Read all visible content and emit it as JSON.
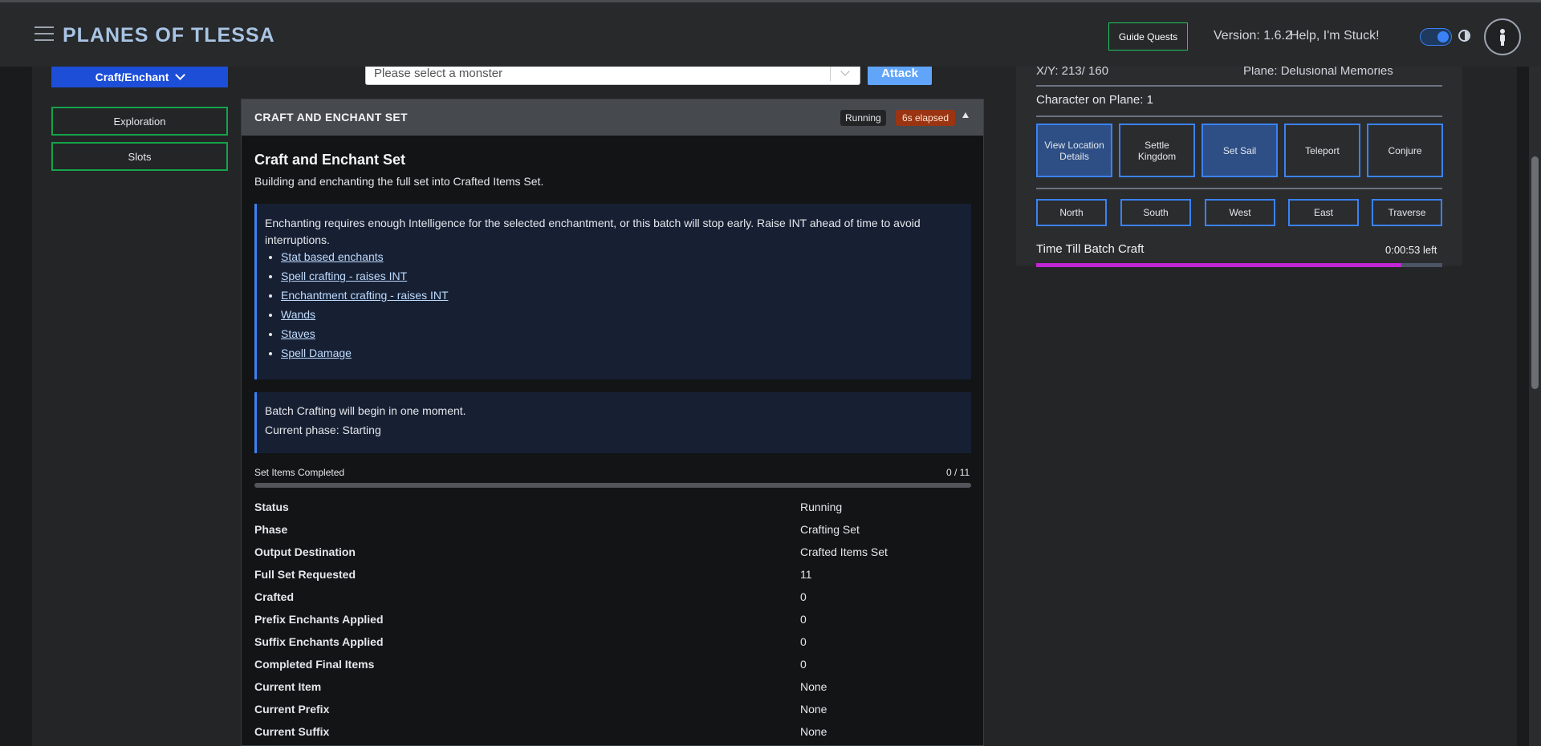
{
  "header": {
    "brand": "PLANES OF TLESSA",
    "guide_quests": "Guide Quests",
    "version": "Version: 1.6.2",
    "help": "Help, I'm Stuck!"
  },
  "sidebar": {
    "craft_enchant": "Craft/Enchant",
    "exploration": "Exploration",
    "slots": "Slots"
  },
  "attack_bar": {
    "monster_placeholder": "Please select a monster",
    "attack_label": "Attack"
  },
  "panel": {
    "header_title": "CRAFT AND ENCHANT SET",
    "status_badge": "Running",
    "elapsed_badge": "6s elapsed",
    "title": "Craft and Enchant Set",
    "subtitle": "Building and enchanting the full set into Crafted Items Set.",
    "notice_text": "Enchanting requires enough Intelligence for the selected enchantment, or this batch will stop early. Raise INT ahead of time to avoid interruptions.",
    "links": [
      "Stat based enchants",
      "Spell crafting - raises INT",
      "Enchantment crafting - raises INT",
      "Wands",
      "Staves",
      "Spell Damage"
    ],
    "batch_msg": "Batch Crafting will begin in one moment.",
    "phase_msg": "Current phase: Starting",
    "progress_label": "Set Items Completed",
    "progress_count": "0 / 11",
    "progress_fraction": 0,
    "stats": [
      {
        "k": "Status",
        "v": "Running"
      },
      {
        "k": "Phase",
        "v": "Crafting Set"
      },
      {
        "k": "Output Destination",
        "v": "Crafted Items Set"
      },
      {
        "k": "Full Set Requested",
        "v": "11"
      },
      {
        "k": "Crafted",
        "v": "0"
      },
      {
        "k": "Prefix Enchants Applied",
        "v": "0"
      },
      {
        "k": "Suffix Enchants Applied",
        "v": "0"
      },
      {
        "k": "Completed Final Items",
        "v": "0"
      },
      {
        "k": "Current Item",
        "v": "None"
      },
      {
        "k": "Current Prefix",
        "v": "None"
      },
      {
        "k": "Current Suffix",
        "v": "None"
      }
    ]
  },
  "map": {
    "cut_left": "X/Y: 213/ 160",
    "cut_right": "Plane: Delusional Memories",
    "char_on_plane": "Character on Plane: 1",
    "actions": [
      "View Location Details",
      "Settle Kingdom",
      "Set Sail",
      "Teleport",
      "Conjure"
    ],
    "directions": [
      "North",
      "South",
      "West",
      "East",
      "Traverse"
    ],
    "timer_label": "Time Till Batch Craft",
    "timer_value": "0:00:53 left",
    "timer_fraction": 0.9
  },
  "colors": {
    "accent": "#3b82f6",
    "craft_btn": "#1d4ed8",
    "nav_border": "#16a34a",
    "elapsed": "#9a3412",
    "timer": "#c026d3"
  }
}
